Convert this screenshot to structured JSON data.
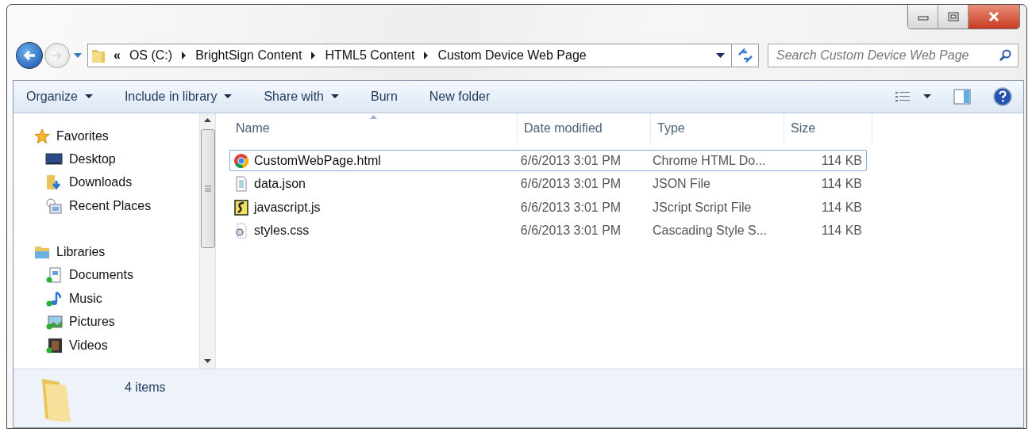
{
  "address": {
    "overflow": "«",
    "crumbs": [
      "OS (C:)",
      "BrightSign Content",
      "HTML5 Content",
      "Custom Device Web Page"
    ]
  },
  "search": {
    "placeholder": "Search Custom Device Web Page"
  },
  "toolbar": {
    "buttons": [
      {
        "label": "Organize",
        "dropdown": true
      },
      {
        "label": "Include in library",
        "dropdown": true
      },
      {
        "label": "Share with",
        "dropdown": true
      },
      {
        "label": "Burn",
        "dropdown": false
      },
      {
        "label": "New folder",
        "dropdown": false
      }
    ]
  },
  "sidebar": {
    "groups": [
      {
        "label": "Favorites",
        "kind": "star",
        "children": [
          {
            "label": "Desktop",
            "kind": "desktop"
          },
          {
            "label": "Downloads",
            "kind": "downloads"
          },
          {
            "label": "Recent Places",
            "kind": "recent"
          }
        ]
      },
      {
        "label": "Libraries",
        "kind": "library",
        "children": [
          {
            "label": "Documents",
            "kind": "documents"
          },
          {
            "label": "Music",
            "kind": "music"
          },
          {
            "label": "Pictures",
            "kind": "pictures"
          },
          {
            "label": "Videos",
            "kind": "videos"
          }
        ]
      }
    ]
  },
  "table": {
    "columns": [
      {
        "label": "Name",
        "sorted": true
      },
      {
        "label": "Date modified",
        "sorted": false
      },
      {
        "label": "Type",
        "sorted": false
      },
      {
        "label": "Size",
        "sorted": false
      }
    ],
    "rows": [
      {
        "kind": "html",
        "name": "CustomWebPage.html",
        "date": "6/6/2013 3:01 PM",
        "type": "Chrome HTML Do...",
        "size": "114 KB",
        "selected": true
      },
      {
        "kind": "json",
        "name": "data.json",
        "date": "6/6/2013 3:01 PM",
        "type": "JSON File",
        "size": "114 KB",
        "selected": false
      },
      {
        "kind": "js",
        "name": "javascript.js",
        "date": "6/6/2013 3:01 PM",
        "type": "JScript Script File",
        "size": "114 KB",
        "selected": false
      },
      {
        "kind": "css",
        "name": "styles.css",
        "date": "6/6/2013 3:01 PM",
        "type": "Cascading Style S...",
        "size": "114 KB",
        "selected": false
      }
    ]
  },
  "details": {
    "count": "4 items"
  }
}
